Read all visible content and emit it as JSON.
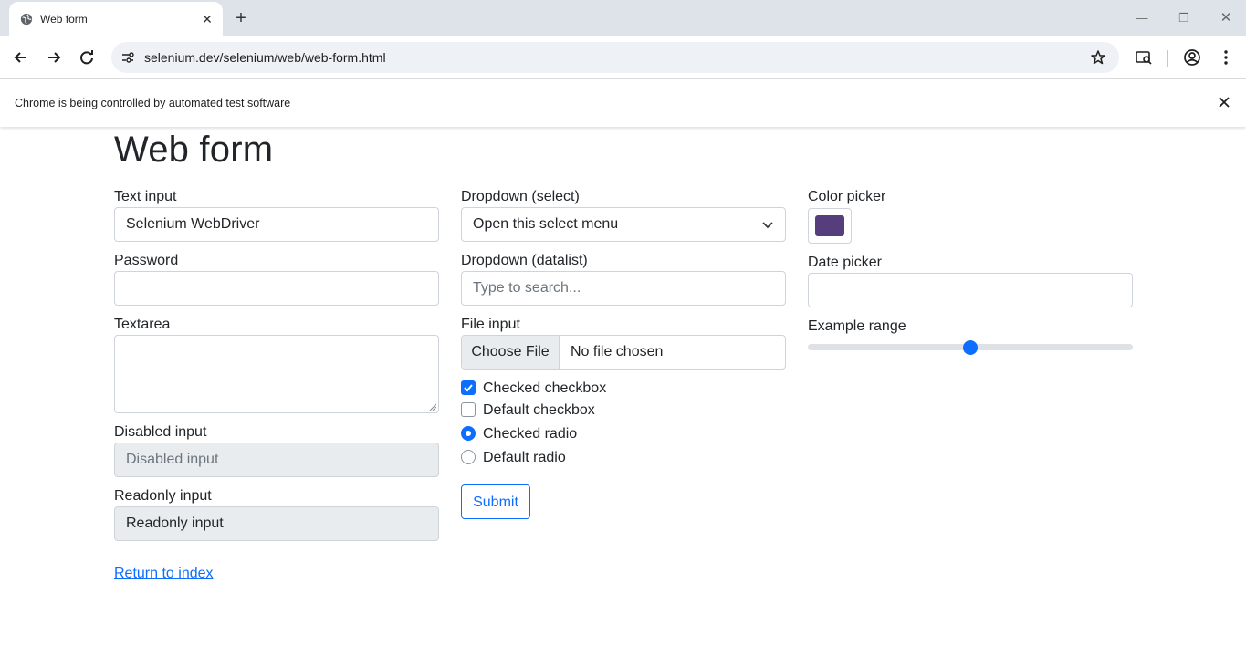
{
  "browser": {
    "tab_title": "Web form",
    "new_tab_label": "+",
    "url": "selenium.dev/selenium/web/web-form.html",
    "infobar_text": "Chrome is being controlled by automated test software"
  },
  "form": {
    "title": "Web form",
    "text_input": {
      "label": "Text input",
      "value": "Selenium WebDriver"
    },
    "password": {
      "label": "Password",
      "value": ""
    },
    "textarea": {
      "label": "Textarea",
      "value": ""
    },
    "disabled_input": {
      "label": "Disabled input",
      "placeholder": "Disabled input"
    },
    "readonly_input": {
      "label": "Readonly input",
      "value": "Readonly input"
    },
    "dropdown_select": {
      "label": "Dropdown (select)",
      "selected": "Open this select menu"
    },
    "dropdown_datalist": {
      "label": "Dropdown (datalist)",
      "placeholder": "Type to search..."
    },
    "file_input": {
      "label": "File input",
      "button": "Choose File",
      "status": "No file chosen"
    },
    "checked_checkbox": {
      "label": "Checked checkbox",
      "checked": true
    },
    "default_checkbox": {
      "label": "Default checkbox",
      "checked": false
    },
    "checked_radio": {
      "label": "Checked radio",
      "checked": true
    },
    "default_radio": {
      "label": "Default radio",
      "checked": false
    },
    "submit_label": "Submit",
    "color_picker": {
      "label": "Color picker",
      "value": "#563d7c"
    },
    "date_picker": {
      "label": "Date picker",
      "value": ""
    },
    "range": {
      "label": "Example range",
      "value": 5,
      "min": 0,
      "max": 10
    },
    "return_link": "Return to index"
  },
  "colors": {
    "accent": "#0d6efd",
    "text": "#212529",
    "swatch": "#563d7c"
  }
}
